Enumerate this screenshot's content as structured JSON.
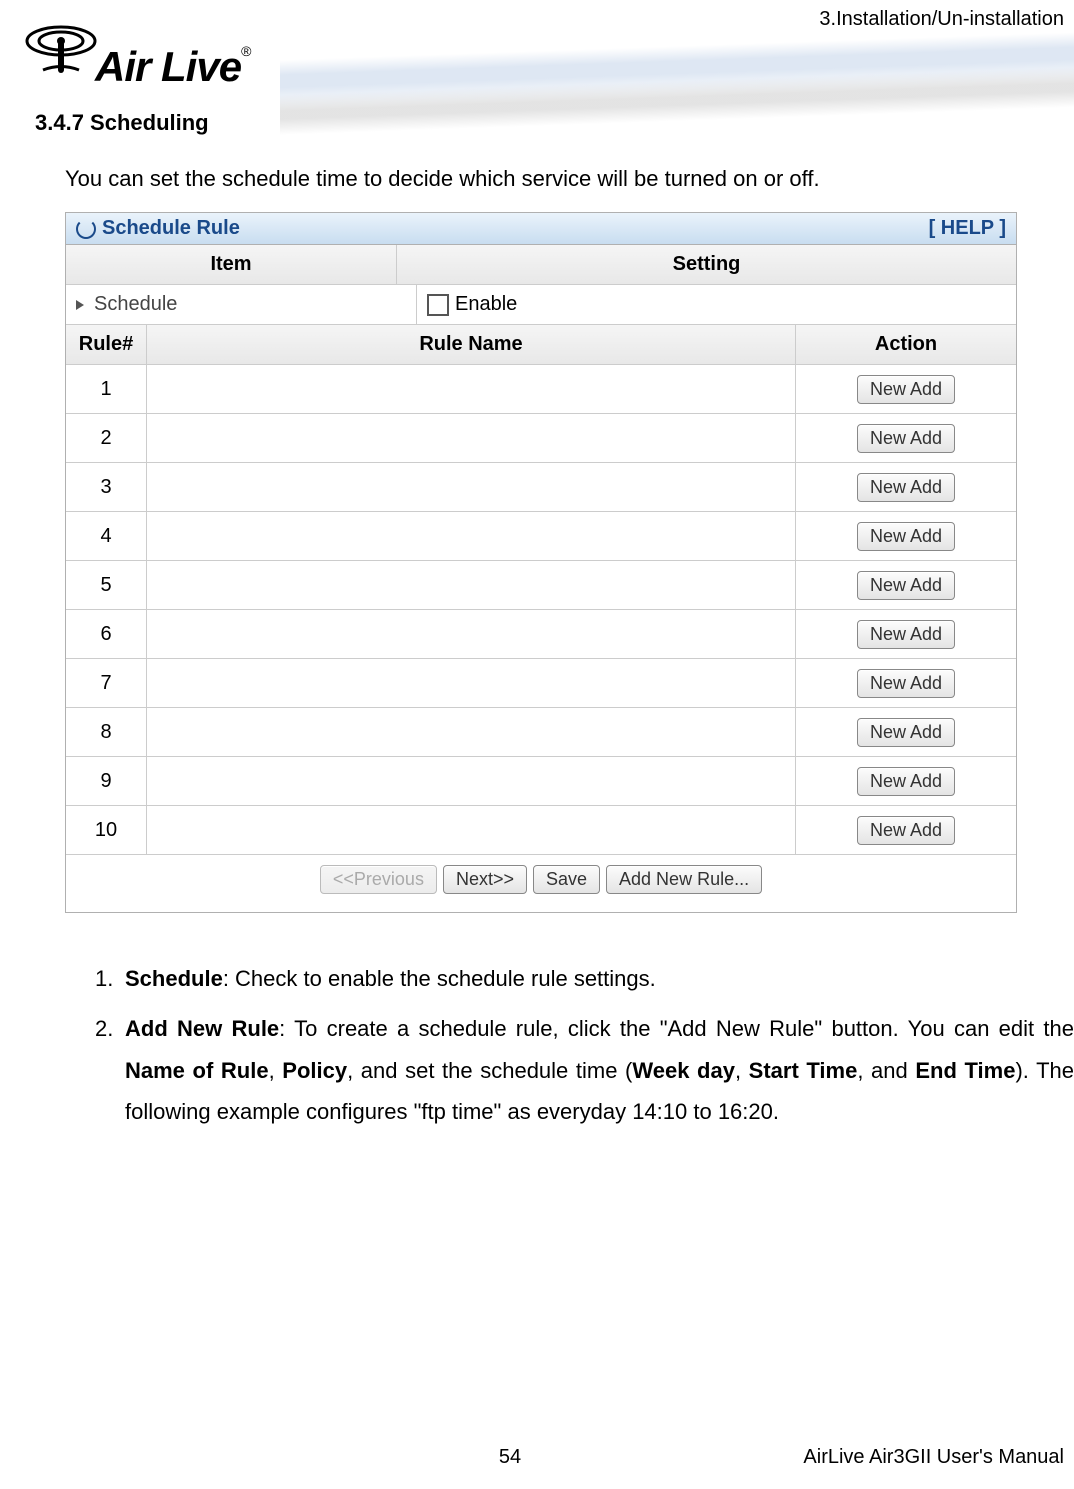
{
  "breadcrumb": "3.Installation/Un-installation",
  "logo": {
    "text": "Air Live",
    "reg": "®"
  },
  "section_title": "3.4.7 Scheduling",
  "intro": "You can set the schedule time to decide which service will be turned on or off.",
  "panel": {
    "title": "Schedule Rule",
    "help": "[ HELP ]",
    "settings_header": {
      "item": "Item",
      "setting": "Setting"
    },
    "schedule_label": "Schedule",
    "enable_label": "Enable",
    "rules_header": {
      "num": "Rule#",
      "name": "Rule Name",
      "action": "Action"
    },
    "rules": [
      {
        "num": "1",
        "name": "",
        "action": "New Add"
      },
      {
        "num": "2",
        "name": "",
        "action": "New Add"
      },
      {
        "num": "3",
        "name": "",
        "action": "New Add"
      },
      {
        "num": "4",
        "name": "",
        "action": "New Add"
      },
      {
        "num": "5",
        "name": "",
        "action": "New Add"
      },
      {
        "num": "6",
        "name": "",
        "action": "New Add"
      },
      {
        "num": "7",
        "name": "",
        "action": "New Add"
      },
      {
        "num": "8",
        "name": "",
        "action": "New Add"
      },
      {
        "num": "9",
        "name": "",
        "action": "New Add"
      },
      {
        "num": "10",
        "name": "",
        "action": "New Add"
      }
    ],
    "buttons": {
      "prev": "<<Previous",
      "next": "Next>>",
      "save": "Save",
      "add": "Add New Rule..."
    }
  },
  "list": {
    "item1_num": "1.",
    "item1_bold": "Schedule",
    "item1_rest": ": Check to enable the schedule rule settings.",
    "item2_num": "2.",
    "item2_bold1": "Add New Rule",
    "item2_t1": ": To create a schedule rule, click the \"Add New Rule\" button. You can edit the ",
    "item2_bold2": "Name of Rule",
    "item2_t2": ", ",
    "item2_bold3": "Policy",
    "item2_t3": ", and set the schedule time (",
    "item2_bold4": "Week day",
    "item2_t4": ", ",
    "item2_bold5": "Start Time",
    "item2_t5": ", and ",
    "item2_bold6": "End Time",
    "item2_t6": "). The following example configures \"ftp time\" as everyday 14:10 to 16:20."
  },
  "footer": {
    "page": "54",
    "manual": "AirLive Air3GII User's Manual"
  }
}
